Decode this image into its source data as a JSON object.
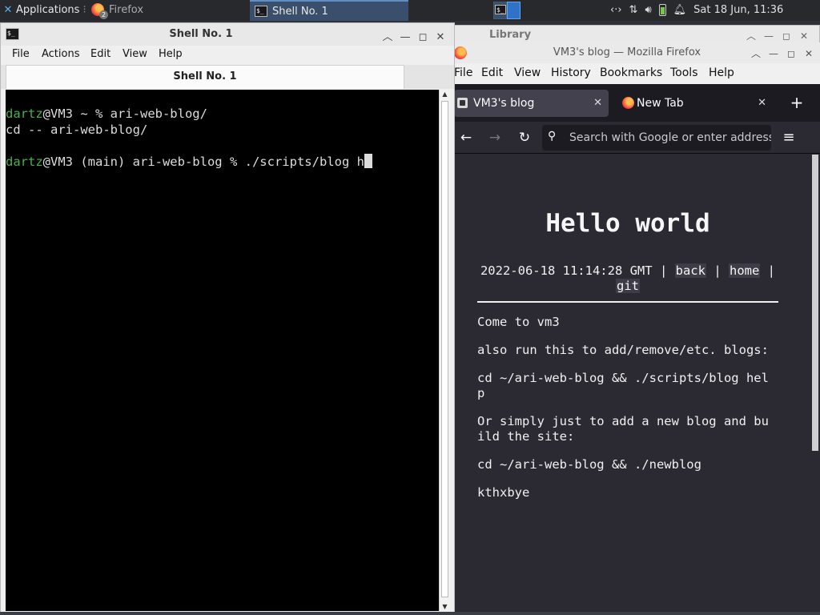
{
  "panel": {
    "apps_label": "Applications",
    "firefox_task": "Firefox",
    "firefox_badge": "2",
    "shell_task": "Shell No. 1",
    "clock": "Sat 18 Jun, 11:36"
  },
  "library": {
    "title": "Library"
  },
  "terminal": {
    "title": "Shell No. 1",
    "menu": [
      "File",
      "Actions",
      "Edit",
      "View",
      "Help"
    ],
    "tab_label": "Shell No. 1",
    "lines": [
      {
        "user": "dartz",
        "rest": "@VM3 ~ % ari-web-blog/"
      },
      {
        "user": "",
        "rest": "cd -- ari-web-blog/"
      },
      {
        "user": "",
        "rest": ""
      },
      {
        "user": "dartz",
        "rest": "@VM3 (main) ari-web-blog % ./scripts/blog h"
      }
    ]
  },
  "firefox": {
    "window_title": "VM3's blog — Mozilla Firefox",
    "menu": [
      "File",
      "Edit",
      "View",
      "History",
      "Bookmarks",
      "Tools",
      "Help"
    ],
    "tabs": [
      {
        "label": "VM3's blog",
        "active": true
      },
      {
        "label": "New Tab",
        "active": false
      }
    ],
    "url_placeholder": "Search with Google or enter address",
    "page": {
      "title": "Hello world",
      "meta_date": "2022-06-18 11:14:28 GMT",
      "sep": "|",
      "links": [
        "back",
        "home",
        "git"
      ],
      "paragraphs": [
        "Come to vm3",
        "also run this to add/remove/etc. blogs:",
        "cd ~/ari-web-blog && ./scripts/blog hel\np",
        "Or simply just to add a new blog and bu\nild the site:",
        "cd ~/ari-web-blog && ./newblog",
        "kthxbye"
      ]
    }
  },
  "colors": {
    "terminal_user": "#4caf50",
    "ff_content_bg": "#2b2a33",
    "panel_bg": "#27292d"
  }
}
